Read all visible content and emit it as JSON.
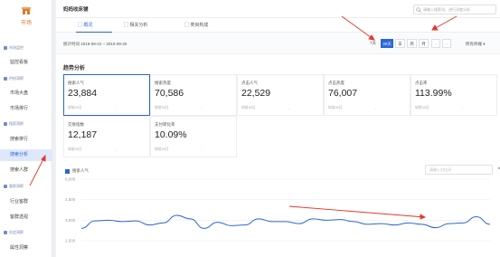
{
  "sidebar": {
    "logo_label": "市场",
    "groups": {
      "g1": "市场监控",
      "g2": "供给洞察",
      "g3": "搜索洞察",
      "g4": "客群洞察",
      "g5": "机会洞察"
    },
    "items": {
      "i1": "监控看板",
      "i2": "市场大盘",
      "i3": "市场排行",
      "i4": "搜索排行",
      "i5": "搜索分析",
      "i6": "搜索人群",
      "i7": "行业客群",
      "i8": "客群透视",
      "i9": "属性洞察"
    }
  },
  "topbar": {
    "title": "妈妈收床铺",
    "search_placeholder": "请输入搜索词，进行深度分析"
  },
  "tabs": {
    "t1": "概况",
    "t2": "相关分析",
    "t3": "类目构成"
  },
  "datebar": {
    "range": "统计时间 2019-08-22 ~ 2019-09-20",
    "periods": {
      "p1": "7天",
      "p2": "30天",
      "p3": "日",
      "p4": "周",
      "p5": "月"
    },
    "active": "30天",
    "channel": "所有终端"
  },
  "trend": {
    "title": "趋势分析",
    "compare_label": "较前30日",
    "dash": "-",
    "metrics": [
      {
        "label": "搜索人气",
        "value": "23,884"
      },
      {
        "label": "搜索热度",
        "value": "70,586"
      },
      {
        "label": "点击人气",
        "value": "22,529"
      },
      {
        "label": "点击热度",
        "value": "76,007"
      },
      {
        "label": "点击率",
        "value": "113.99%"
      },
      {
        "label": "交易指数",
        "value": "12,187"
      },
      {
        "label": "支付转化率",
        "value": "10.09%"
      }
    ]
  },
  "chart_data": {
    "type": "line",
    "series": [
      {
        "name": "搜索人气",
        "values": [
          2400,
          2950,
          3000,
          2900,
          2950,
          2650,
          2800,
          3350,
          3100,
          2400,
          2850,
          2600,
          2650,
          3100,
          2900,
          2900,
          2750,
          3100,
          3000,
          3050,
          2900,
          2700,
          2750,
          2650,
          2800,
          2700,
          2450,
          2750,
          2800,
          3250,
          2700
        ]
      }
    ],
    "yticks": [
      "6,000",
      "4,500",
      "3,000",
      "1,500"
    ],
    "ylim": [
      1500,
      6000
    ],
    "compare_placeholder": "请输入对比词",
    "compare_close": "×"
  },
  "colors": {
    "accent": "#2b66d9",
    "annotation": "#e8342a"
  }
}
